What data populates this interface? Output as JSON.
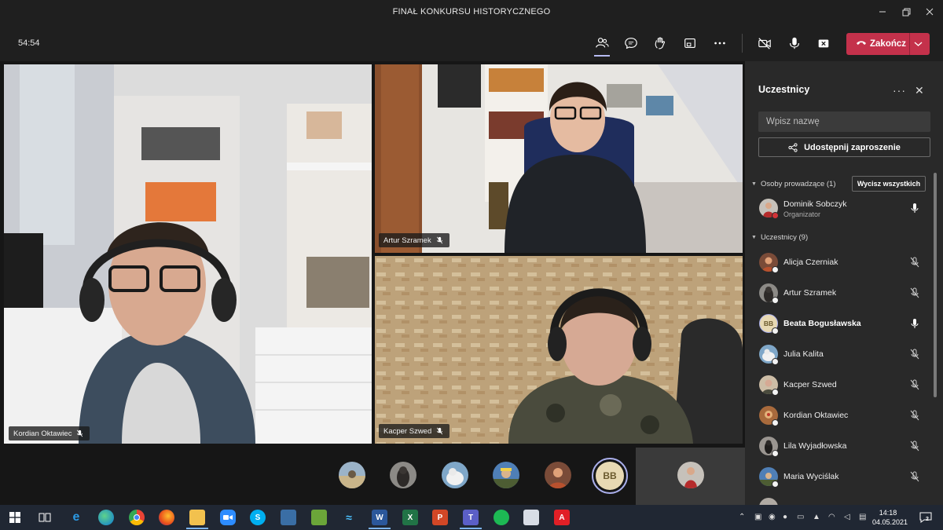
{
  "window": {
    "title": "FINAŁ KONKURSU HISTORYCZNEGO"
  },
  "toolbar": {
    "timer": "54:54",
    "end_label": "Zakończ"
  },
  "tiles": {
    "kordian": "Kordian Oktawiec",
    "artur": "Artur Szramek",
    "kacper": "Kacper Szwed"
  },
  "thumb_strip": {
    "bb_initials": "BB"
  },
  "panel": {
    "title": "Uczestnicy",
    "search_placeholder": "Wpisz nazwę",
    "share_label": "Udostępnij zaproszenie",
    "presenters_label": "Osoby prowadzące (1)",
    "mute_all_label": "Wycisz wszystkich",
    "organizer": {
      "name": "Dominik Sobczyk",
      "role": "Organizator"
    },
    "attendees_label": "Uczestnicy (9)",
    "attendees": [
      {
        "name": "Alicja Czerniak"
      },
      {
        "name": "Artur Szramek"
      },
      {
        "name": "Beata Bogusławska",
        "initials": "BB"
      },
      {
        "name": "Julia Kalita"
      },
      {
        "name": "Kacper Szwed"
      },
      {
        "name": "Kordian Oktawiec"
      },
      {
        "name": "Lila Wyjadłowska"
      },
      {
        "name": "Maria Wyciślak"
      }
    ]
  },
  "taskbar": {
    "time": "14:18",
    "date": "04.05.2021",
    "notification_count": "2"
  },
  "colors": {
    "end_call": "#c4314b",
    "panel_bg": "#292929",
    "app_bg": "#1f1f1f",
    "taskbar_bg": "#202733"
  }
}
